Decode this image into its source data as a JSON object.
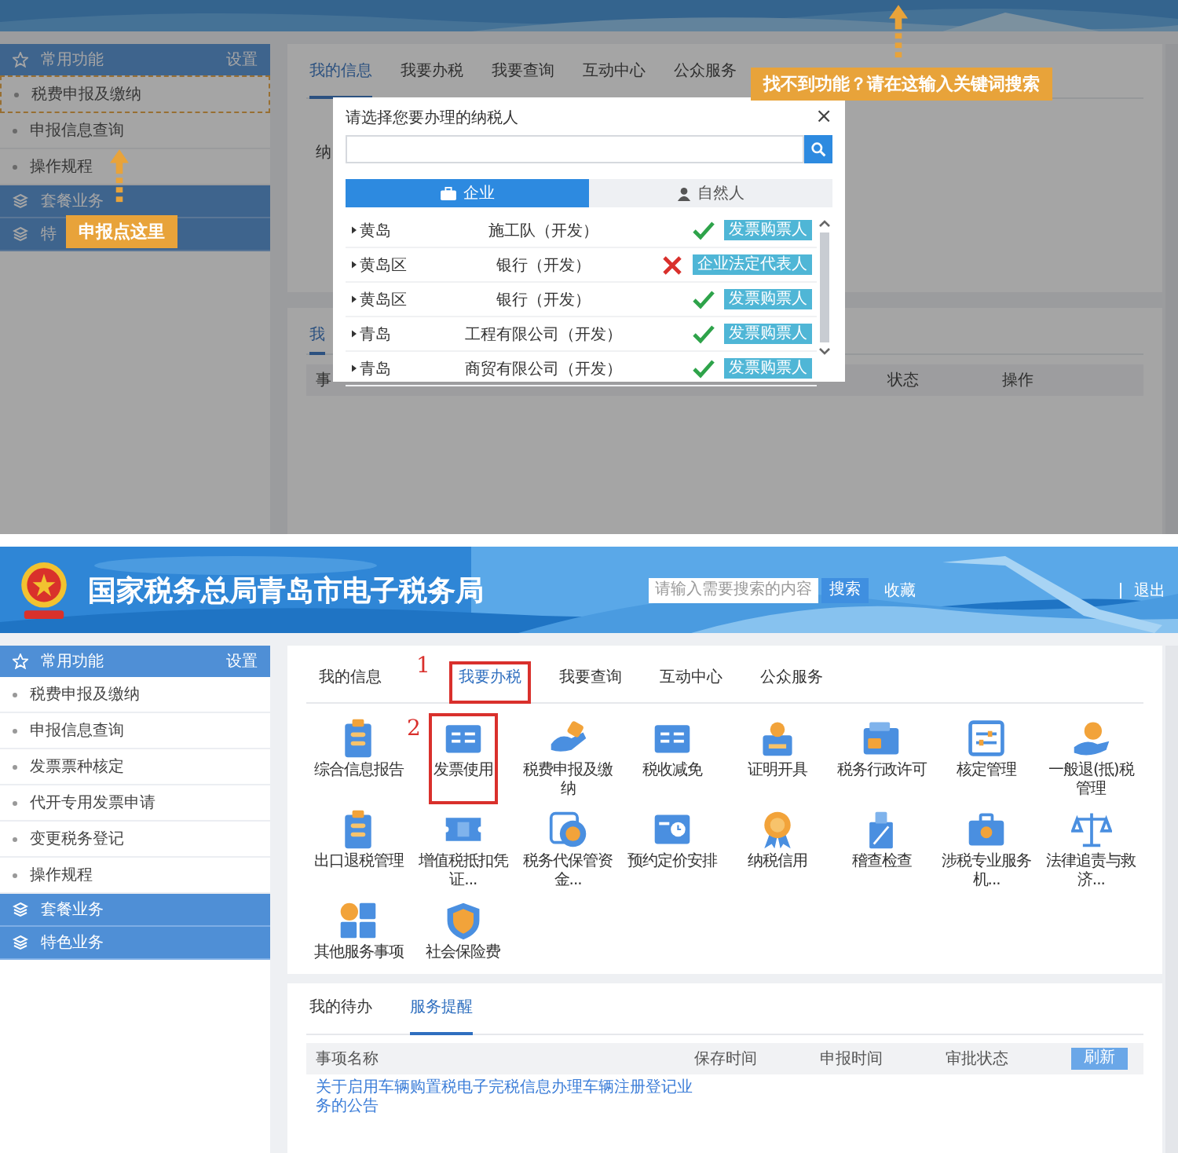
{
  "top_screen": {
    "sidebar": {
      "title": "常用功能",
      "settings": "设置",
      "items": [
        {
          "label": "税费申报及缴纳",
          "highlighted": true
        },
        {
          "label": "申报信息查询",
          "highlighted": false
        },
        {
          "label": "操作规程",
          "highlighted": false
        }
      ],
      "groups": [
        "套餐业务",
        "特"
      ]
    },
    "sidebar_hint": "申报点这里",
    "tabs": [
      {
        "label": "我的信息",
        "selected": true
      },
      {
        "label": "我要办税",
        "selected": false
      },
      {
        "label": "我要查询",
        "selected": false
      },
      {
        "label": "互动中心",
        "selected": false
      },
      {
        "label": "公众服务",
        "selected": false
      }
    ],
    "search_hint": "找不到功能？请在这输入关键词搜索",
    "info_label": "纳",
    "lower_tab": "我",
    "lower_columns": [
      "事",
      "状态",
      "操作"
    ],
    "modal": {
      "title": "请选择您要办理的纳税人",
      "close": "×",
      "tabs": [
        {
          "label": "企业",
          "selected": true
        },
        {
          "label": "自然人",
          "selected": false
        }
      ],
      "rows": [
        {
          "region": "黄岛",
          "name": "施工队（开发）",
          "valid": true,
          "role": "发票购票人"
        },
        {
          "region": "黄岛区",
          "name": "银行（开发）",
          "valid": false,
          "role": "企业法定代表人"
        },
        {
          "region": "黄岛区",
          "name": "银行（开发）",
          "valid": true,
          "role": "发票购票人"
        },
        {
          "region": "青岛",
          "name": "工程有限公司（开发）",
          "valid": true,
          "role": "发票购票人"
        },
        {
          "region": "青岛",
          "name": "商贸有限公司（开发）",
          "valid": true,
          "role": "发票购票人"
        }
      ]
    }
  },
  "bottom_screen": {
    "header": {
      "title": "国家税务总局青岛市电子税务局",
      "search": {
        "placeholder": "请输入需要搜索的内容"
      },
      "search_button": "搜索",
      "favorite": "收藏",
      "logout": "退出"
    },
    "sidebar": {
      "title": "常用功能",
      "settings": "设置",
      "items": [
        "税费申报及缴纳",
        "申报信息查询",
        "发票票种核定",
        "代开专用发票申请",
        "变更税务登记",
        "操作规程"
      ],
      "groups": [
        "套餐业务",
        "特色业务"
      ]
    },
    "tabs": [
      {
        "label": "我的信息",
        "selected": false,
        "highlighted": false
      },
      {
        "label": "我要办税",
        "selected": true,
        "highlighted": true,
        "marker": "1"
      },
      {
        "label": "我要查询",
        "selected": false,
        "highlighted": false
      },
      {
        "label": "互动中心",
        "selected": false,
        "highlighted": false
      },
      {
        "label": "公众服务",
        "selected": false,
        "highlighted": false
      }
    ],
    "services": [
      {
        "label": "综合信息报告",
        "highlighted": false
      },
      {
        "label": "发票使用",
        "highlighted": true,
        "marker": "2"
      },
      {
        "label": "税费申报及缴纳",
        "highlighted": false
      },
      {
        "label": "税收减免",
        "highlighted": false
      },
      {
        "label": "证明开具",
        "highlighted": false
      },
      {
        "label": "税务行政许可",
        "highlighted": false
      },
      {
        "label": "核定管理",
        "highlighted": false
      },
      {
        "label": "一般退(抵)税管理",
        "highlighted": false
      },
      {
        "label": "出口退税管理",
        "highlighted": false
      },
      {
        "label": "增值税抵扣凭证...",
        "highlighted": false
      },
      {
        "label": "税务代保管资金...",
        "highlighted": false
      },
      {
        "label": "预约定价安排",
        "highlighted": false
      },
      {
        "label": "纳税信用",
        "highlighted": false
      },
      {
        "label": "稽查检查",
        "highlighted": false
      },
      {
        "label": "涉税专业服务机...",
        "highlighted": false
      },
      {
        "label": "法律追责与救济...",
        "highlighted": false
      },
      {
        "label": "其他服务事项",
        "highlighted": false
      },
      {
        "label": "社会保险费",
        "highlighted": false
      }
    ],
    "todo": {
      "tabs": [
        {
          "label": "我的待办",
          "selected": false
        },
        {
          "label": "服务提醒",
          "selected": true
        }
      ],
      "columns": [
        "事项名称",
        "保存时间",
        "申报时间",
        "审批状态"
      ],
      "refresh": "刷新",
      "rows": [
        {
          "title": "关于启用车辆购置税电子完税信息办理车辆注册登记业务的公告"
        }
      ]
    }
  }
}
